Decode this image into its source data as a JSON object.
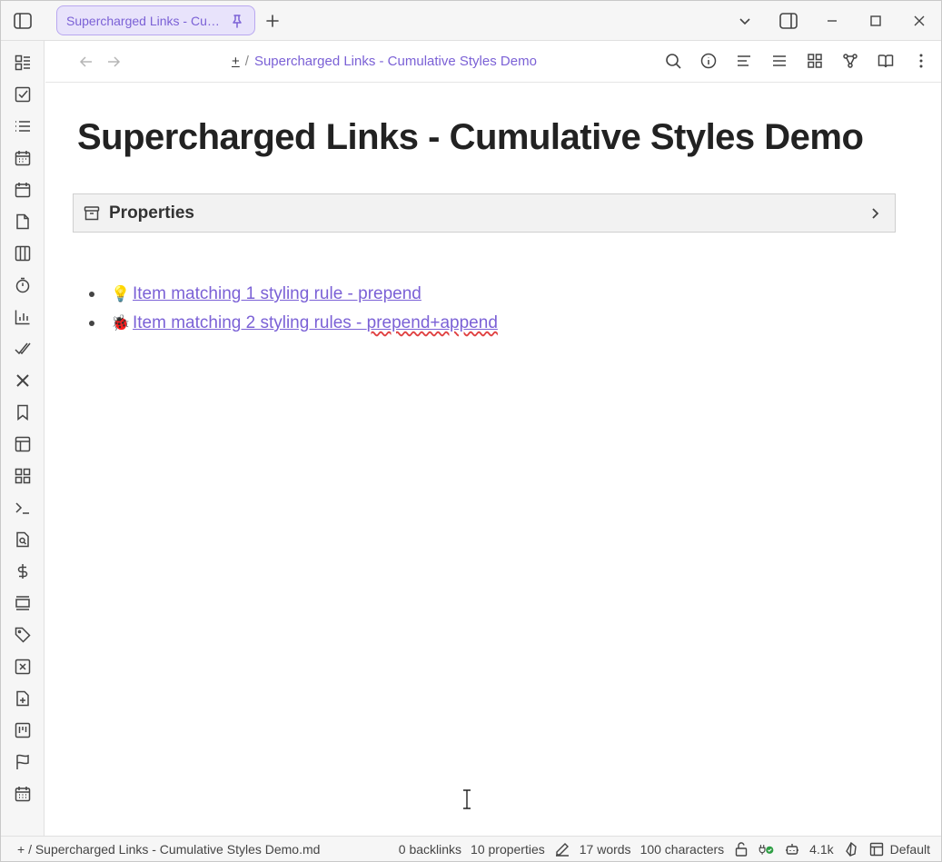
{
  "tab": {
    "label": "Supercharged Links - Cumulative Styles Demo"
  },
  "breadcrumb": {
    "root": "+",
    "separator": "/",
    "title": "Supercharged Links - Cumulative Styles Demo"
  },
  "page": {
    "title": "Supercharged Links - Cumulative Styles Demo"
  },
  "properties": {
    "label": "Properties"
  },
  "list": {
    "items": [
      {
        "emoji": "💡",
        "text": "Item matching 1 styling rule - prepend"
      },
      {
        "emoji": "🐞",
        "text_plain": "Item matching 2 styling rules - ",
        "text_flagged": "prepend+append"
      }
    ]
  },
  "statusbar": {
    "path": "+ / Supercharged Links - Cumulative Styles Demo.md",
    "backlinks": "0 backlinks",
    "properties": "10 properties",
    "words": "17 words",
    "characters": "100 characters",
    "tokens": "4.1k",
    "layout": "Default"
  },
  "colors": {
    "accent": "#7b61d6",
    "tab_bg": "#e8e3fb",
    "chrome_bg": "#f6f6f6"
  }
}
